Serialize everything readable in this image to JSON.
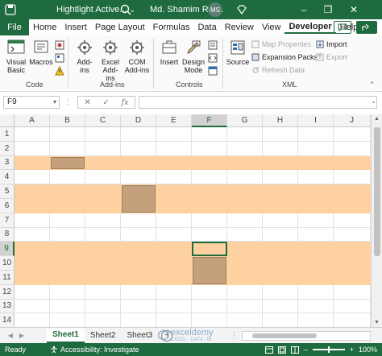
{
  "titlebar": {
    "title": "Hightlight Active...",
    "user": "Md. Shamim Reza",
    "avatar": "MS"
  },
  "tabs": [
    {
      "label": "File"
    },
    {
      "label": "Home"
    },
    {
      "label": "Insert"
    },
    {
      "label": "Page Layout"
    },
    {
      "label": "Formulas"
    },
    {
      "label": "Data"
    },
    {
      "label": "Review"
    },
    {
      "label": "View"
    },
    {
      "label": "Developer"
    },
    {
      "label": "Help"
    }
  ],
  "ribbon": {
    "code": {
      "label": "Code",
      "visual_basic": "Visual Basic",
      "macros": "Macros"
    },
    "addins": {
      "label": "Add-ins",
      "addins": "Add-ins",
      "excel_addins": "Excel Add-ins",
      "com_addins": "COM Add-ins"
    },
    "controls": {
      "label": "Controls",
      "insert": "Insert",
      "design_mode": "Design Mode"
    },
    "xml": {
      "label": "XML",
      "source": "Source",
      "map_properties": "Map Properties",
      "expansion_packs": "Expansion Packs",
      "refresh_data": "Refresh Data",
      "import": "Import",
      "export": "Export"
    }
  },
  "formula_bar": {
    "name_box": "F9",
    "fx": "fx",
    "value": ""
  },
  "grid": {
    "columns": [
      "A",
      "B",
      "C",
      "D",
      "E",
      "F",
      "G",
      "H",
      "I",
      "J"
    ],
    "rows": [
      "1",
      "2",
      "3",
      "4",
      "5",
      "6",
      "7",
      "8",
      "9",
      "10",
      "11",
      "12",
      "13",
      "14"
    ],
    "highlight_color": "#fdd1a0",
    "active_color": "#c4a07c",
    "selected_column": "F",
    "selected_row": "9"
  },
  "sheets": [
    {
      "name": "Sheet1",
      "active": true
    },
    {
      "name": "Sheet2",
      "active": false
    },
    {
      "name": "Sheet3",
      "active": false
    }
  ],
  "watermark": {
    "brand": "exceldemy",
    "tagline": "EXCEL · DATA · BI"
  },
  "status": {
    "ready": "Ready",
    "accessibility": "Accessibility: Investigate",
    "zoom": "100%"
  },
  "colors": {
    "accent": "#1f6b40"
  }
}
